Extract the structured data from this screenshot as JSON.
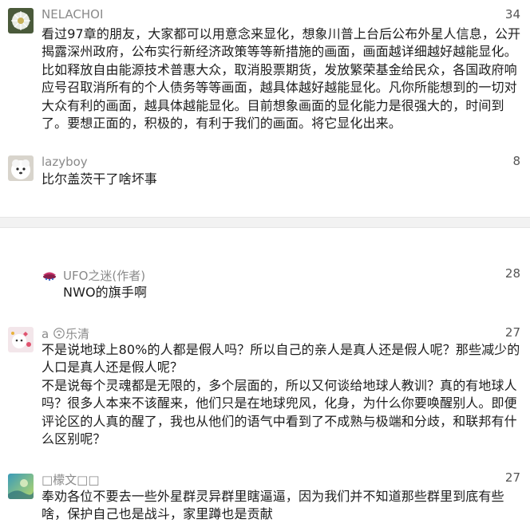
{
  "comments_top": [
    {
      "author": "NELACHOI",
      "likes": "34",
      "text": "看过97章的朋友，大家都可以用意念来显化，想象川普上台后公布外星人信息，公开揭露深州政府，公布实行新经济政策等等新措施的画面，画面越详细越好越能显化。比如释放自由能源技术普惠大众，取消股票期货，发放繁荣基金给民众，各国政府响应号召取消所有的个人债务等等画面，越具体越好越能显化。凡你所能想到的一切对大众有利的画面，越具体越能显化。目前想象画面的显化能力是很强大的，时间到了。要想正面的，积极的，有利于我们的画面。将它显化出来。"
    },
    {
      "author": "lazyboy",
      "likes": "8",
      "text": "比尔盖茨干了啥坏事"
    }
  ],
  "reply_ufo": {
    "author": "UFO之迷(作者)",
    "likes": "28",
    "text": "NWO的旗手啊"
  },
  "comment_a": {
    "author_prefix": "a",
    "author_name": "乐清",
    "likes": "27",
    "para1": "不是说地球上80%的人都是假人吗？所以自己的亲人是真人还是假人呢？那些减少的人口是真人还是假人呢？",
    "para2": "不是说每个灵魂都是无限的，多个层面的，所以又何谈给地球人教训？真的有地球人吗？很多人本来不该醒来，他们只是在地球兜风，化身，为什么你要唤醒别人。即便评论区的人真的醒了，我也从他们的语气中看到了不成熟与极端和分歧，和联邦有什么区别呢？"
  },
  "comment_last": {
    "author": "□檬文□□",
    "likes": "27",
    "text": "奉劝各位不要去一些外星群灵异群里瞎逼逼，因为我们并不知道那些群里到底有些啥，保护自己也是战斗，家里蹲也是贡献"
  },
  "colors": {
    "name": "#8a8a8a",
    "body": "#1c1c1c",
    "divider": "#f2f2f2"
  }
}
